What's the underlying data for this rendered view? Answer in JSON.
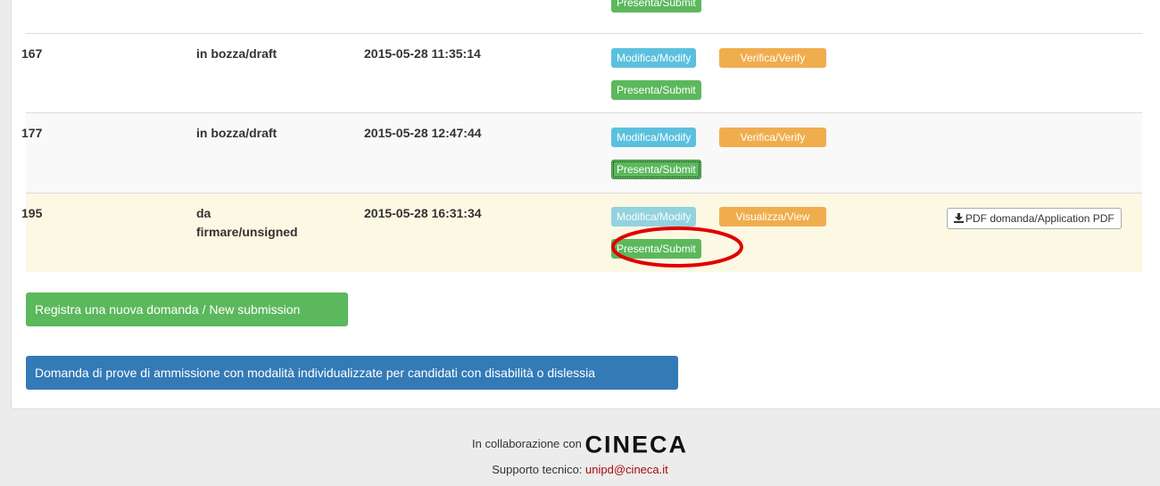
{
  "rows": [
    {
      "id": "167",
      "status": "in bozza/draft",
      "date": "2015-05-28 11:35:14",
      "modify": "Modifica/Modify",
      "second": "Verifica/Verify",
      "submit": "Presenta/Submit"
    },
    {
      "id": "177",
      "status": "in bozza/draft",
      "date": "2015-05-28 12:47:44",
      "modify": "Modifica/Modify",
      "second": "Verifica/Verify",
      "submit": "Presenta/Submit"
    },
    {
      "id": "195",
      "status_line1": "da",
      "status_line2": "firmare/unsigned",
      "date": "2015-05-28 16:31:34",
      "modify": "Modifica/Modify",
      "second": "Visualizza/View",
      "submit": "Presenta/Submit",
      "pdf": "PDF domanda/Application PDF"
    }
  ],
  "top_partial_button": "Presenta/Submit",
  "new_submission": "Registra una nuova domanda / New submission",
  "disability_request": "Domanda di prove di ammissione con modalità individualizzate per candidati con disabilità o dislessia",
  "footer": {
    "collab_text": "In collaborazione con",
    "logo_text": "CINECA",
    "support_label": "Supporto tecnico:",
    "support_email": "unipd@cineca.it"
  },
  "colors": {
    "info": "#5bc0de",
    "warning": "#f0ad4e",
    "success": "#5cb85c",
    "primary": "#337ab7",
    "highlight_row": "#fcf8e3",
    "annotation": "#e00000"
  },
  "icons": {
    "pdf_button": "download-icon"
  }
}
